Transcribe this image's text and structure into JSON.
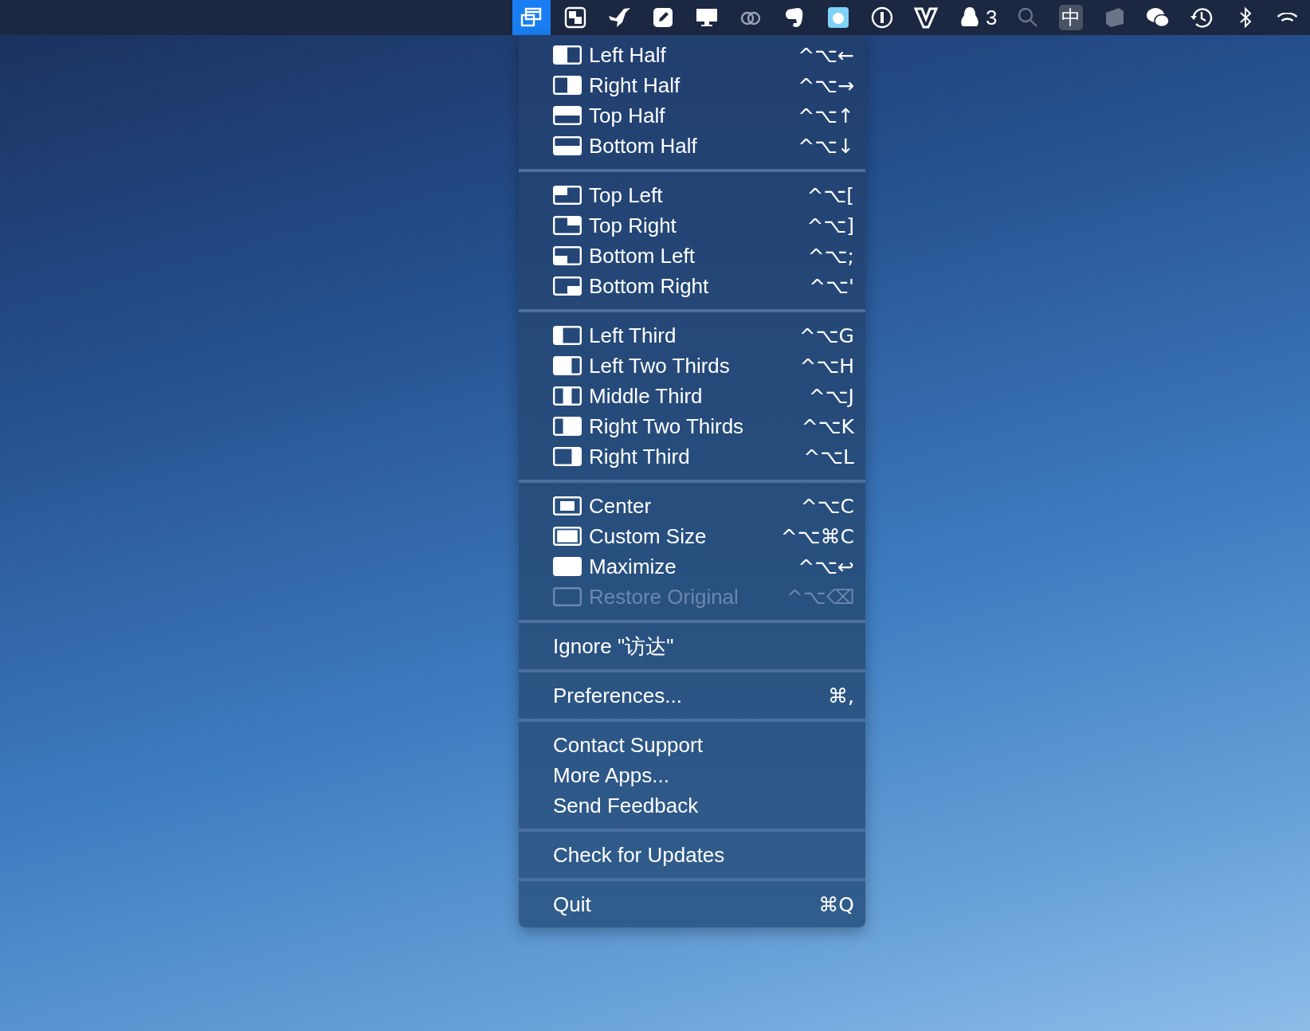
{
  "menu_bar": {
    "items": [
      {
        "selected": true
      },
      {
        "selected": false
      },
      {
        "selected": false
      },
      {
        "selected": false
      },
      {
        "selected": false
      },
      {
        "selected": false
      },
      {
        "selected": false
      },
      {
        "selected": false
      },
      {
        "selected": false
      },
      {
        "selected": false
      },
      {
        "selected": false,
        "badge": "3"
      },
      {
        "selected": false
      },
      {
        "selected": false,
        "text": "中"
      },
      {
        "selected": false
      },
      {
        "selected": false
      },
      {
        "selected": false
      },
      {
        "selected": false
      },
      {
        "selected": false
      }
    ]
  },
  "menu": {
    "sections": [
      {
        "items": [
          {
            "kind": "layout",
            "label": "Left Half",
            "shortcut": "^⌥←",
            "disabled": false
          },
          {
            "kind": "layout",
            "label": "Right Half",
            "shortcut": "^⌥→",
            "disabled": false
          },
          {
            "kind": "layout",
            "label": "Top Half",
            "shortcut": "^⌥↑",
            "disabled": false
          },
          {
            "kind": "layout",
            "label": "Bottom Half",
            "shortcut": "^⌥↓",
            "disabled": false
          }
        ]
      },
      {
        "items": [
          {
            "kind": "layout",
            "label": "Top Left",
            "shortcut": "^⌥[",
            "disabled": false
          },
          {
            "kind": "layout",
            "label": "Top Right",
            "shortcut": "^⌥]",
            "disabled": false
          },
          {
            "kind": "layout",
            "label": "Bottom Left",
            "shortcut": "^⌥;",
            "disabled": false
          },
          {
            "kind": "layout",
            "label": "Bottom Right",
            "shortcut": "^⌥'",
            "disabled": false
          }
        ]
      },
      {
        "items": [
          {
            "kind": "layout",
            "label": "Left Third",
            "shortcut": "^⌥G",
            "disabled": false
          },
          {
            "kind": "layout",
            "label": "Left Two Thirds",
            "shortcut": "^⌥H",
            "disabled": false
          },
          {
            "kind": "layout",
            "label": "Middle Third",
            "shortcut": "^⌥J",
            "disabled": false
          },
          {
            "kind": "layout",
            "label": "Right Two Thirds",
            "shortcut": "^⌥K",
            "disabled": false
          },
          {
            "kind": "layout",
            "label": "Right Third",
            "shortcut": "^⌥L",
            "disabled": false
          }
        ]
      },
      {
        "items": [
          {
            "kind": "layout",
            "label": "Center",
            "shortcut": "^⌥C",
            "disabled": false
          },
          {
            "kind": "layout",
            "label": "Custom Size",
            "shortcut": "^⌥⌘C",
            "disabled": false
          },
          {
            "kind": "layout",
            "label": "Maximize",
            "shortcut": "^⌥↩",
            "disabled": false
          },
          {
            "kind": "layout",
            "label": "Restore Original",
            "shortcut": "^⌥⌫",
            "disabled": true
          }
        ]
      },
      {
        "items": [
          {
            "kind": "plain",
            "label": "Ignore \"访达\"",
            "disabled": false
          }
        ]
      },
      {
        "items": [
          {
            "kind": "plain",
            "label": "Preferences...",
            "shortcut": "⌘,",
            "disabled": false
          }
        ]
      },
      {
        "items": [
          {
            "kind": "plain",
            "label": "Contact Support",
            "disabled": false
          },
          {
            "kind": "plain",
            "label": "More Apps...",
            "disabled": false
          },
          {
            "kind": "plain",
            "label": "Send Feedback",
            "disabled": false
          }
        ]
      },
      {
        "items": [
          {
            "kind": "plain",
            "label": "Check for Updates",
            "disabled": false
          }
        ]
      },
      {
        "items": [
          {
            "kind": "plain",
            "label": "Quit",
            "shortcut": "⌘Q",
            "disabled": false
          }
        ]
      }
    ]
  }
}
